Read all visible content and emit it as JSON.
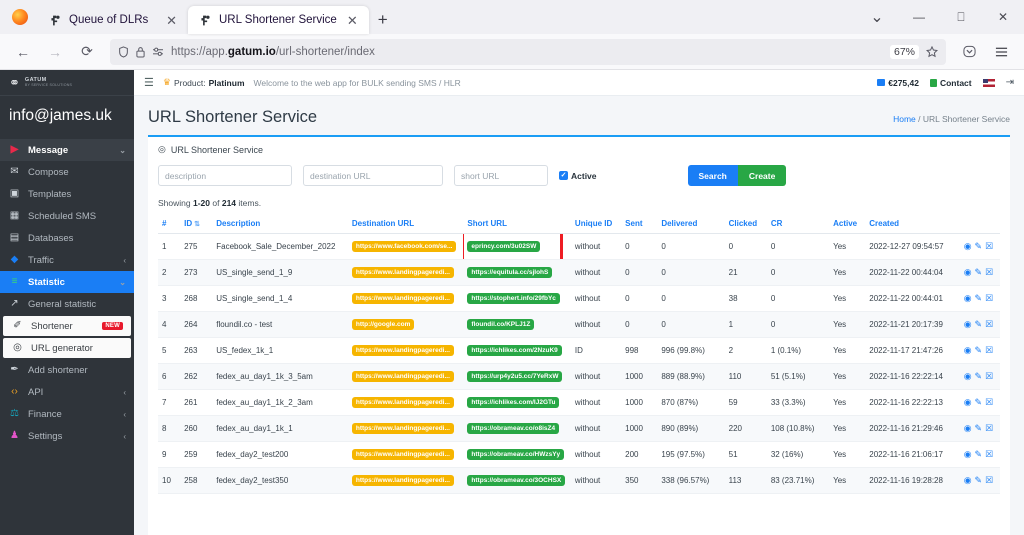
{
  "browser": {
    "tabs": [
      {
        "title": "Queue of DLRs",
        "active": false
      },
      {
        "title": "URL Shortener Service",
        "active": true
      }
    ],
    "new_tab_label": "+",
    "url_prefix": "https://app.",
    "url_domain": "gatum.io",
    "url_path": "/url-shortener/index",
    "zoom_level": "67%",
    "window_controls": {
      "minimize": "—",
      "maximize": "❐",
      "close": "✕"
    }
  },
  "sidebar": {
    "brand_line1": "GATUM",
    "brand_line2": "BY SERVICE SOLUTIONS",
    "account": "info@james.uk",
    "items": [
      {
        "label": "Message",
        "icon": "message-icon",
        "chevron": "⌄",
        "style": "group"
      },
      {
        "label": "Compose",
        "icon": "envelope-icon",
        "chevron": "",
        "style": "plain"
      },
      {
        "label": "Templates",
        "icon": "template-icon",
        "chevron": "",
        "style": "plain"
      },
      {
        "label": "Scheduled SMS",
        "icon": "calendar-icon",
        "chevron": "",
        "style": "plain"
      },
      {
        "label": "Databases",
        "icon": "database-icon",
        "chevron": "",
        "style": "plain"
      },
      {
        "label": "Traffic",
        "icon": "traffic-icon",
        "chevron": "‹",
        "style": "plain"
      },
      {
        "label": "Statistic",
        "icon": "chart-icon",
        "chevron": "⌄",
        "style": "active-blue"
      },
      {
        "label": "General statistic",
        "icon": "line-chart-icon",
        "chevron": "",
        "style": "plain"
      },
      {
        "label": "Shortener",
        "icon": "pencil-icon",
        "chevron": "",
        "style": "white",
        "badge": "NEW"
      },
      {
        "label": "URL generator",
        "icon": "target-icon",
        "chevron": "",
        "style": "white"
      },
      {
        "label": "Add shortener",
        "icon": "quill-icon",
        "chevron": "",
        "style": "plain"
      },
      {
        "label": "API",
        "icon": "code-icon",
        "chevron": "‹",
        "style": "plain"
      },
      {
        "label": "Finance",
        "icon": "finance-icon",
        "chevron": "‹",
        "style": "plain"
      },
      {
        "label": "Settings",
        "icon": "users-icon",
        "chevron": "‹",
        "style": "plain"
      }
    ]
  },
  "topbar": {
    "product_label": "Product:",
    "product_value": "Platinum",
    "welcome": "Welcome to the web app for BULK sending SMS / HLR",
    "balance": "€275,42",
    "contact": "Contact",
    "language": "en-US"
  },
  "page": {
    "title": "URL Shortener Service",
    "breadcrumb_home": "Home",
    "breadcrumb_sep": "/",
    "breadcrumb_current": "URL Shortener Service",
    "panel_title": "URL Shortener Service"
  },
  "filters": {
    "description_placeholder": "description",
    "destination_placeholder": "destination URL",
    "short_placeholder": "short URL",
    "active_label": "Active",
    "active_checked": true,
    "search_label": "Search",
    "create_label": "Create"
  },
  "summary": {
    "prefix": "Showing",
    "range": "1-20",
    "of": "of",
    "total": "214",
    "suffix": "items."
  },
  "table": {
    "columns": [
      "#",
      "ID",
      "Description",
      "Destination URL",
      "Short URL",
      "Unique ID",
      "Sent",
      "Delivered",
      "Clicked",
      "CR",
      "Active",
      "Created",
      ""
    ],
    "sort_column": "ID",
    "rows": [
      {
        "n": "1",
        "id": "275",
        "desc": "Facebook_Sale_December_2022",
        "dest": "https://www.facebook.com/se...",
        "short": "eprincy.com/3u02SW",
        "uid": "without",
        "sent": "0",
        "delivered": "0",
        "clicked": "0",
        "cr": "0",
        "active": "Yes",
        "created": "2022-12-27 09:54:57",
        "highlight": true
      },
      {
        "n": "2",
        "id": "273",
        "desc": "US_single_send_1_9",
        "dest": "https://www.landingpageredi...",
        "short": "https://equitula.cc/sjIohS",
        "uid": "without",
        "sent": "0",
        "delivered": "0",
        "clicked": "21",
        "cr": "0",
        "active": "Yes",
        "created": "2022-11-22 00:44:04",
        "highlight": false
      },
      {
        "n": "3",
        "id": "268",
        "desc": "US_single_send_1_4",
        "dest": "https://www.landingpageredi...",
        "short": "https://stophert.info/29fbYc",
        "uid": "without",
        "sent": "0",
        "delivered": "0",
        "clicked": "38",
        "cr": "0",
        "active": "Yes",
        "created": "2022-11-22 00:44:01",
        "highlight": false
      },
      {
        "n": "4",
        "id": "264",
        "desc": "floundil.co - test",
        "dest": "http://google.com",
        "short": "floundil.co/KPLJ1Z",
        "uid": "without",
        "sent": "0",
        "delivered": "0",
        "clicked": "1",
        "cr": "0",
        "active": "Yes",
        "created": "2022-11-21 20:17:39",
        "highlight": false
      },
      {
        "n": "5",
        "id": "263",
        "desc": "US_fedex_1k_1",
        "dest": "https://www.landingpageredi...",
        "short": "https://ichlikes.com/2NzuK9",
        "uid": "ID",
        "sent": "998",
        "delivered": "996 (99.8%)",
        "clicked": "2",
        "cr": "1 (0.1%)",
        "active": "Yes",
        "created": "2022-11-17 21:47:26",
        "highlight": false
      },
      {
        "n": "6",
        "id": "262",
        "desc": "fedex_au_day1_1k_3_5am",
        "dest": "https://www.landingpageredi...",
        "short": "https://urp4y2u5.cc/7YeRxW",
        "uid": "without",
        "sent": "1000",
        "delivered": "889 (88.9%)",
        "clicked": "110",
        "cr": "51 (5.1%)",
        "active": "Yes",
        "created": "2022-11-16 22:22:14",
        "highlight": false
      },
      {
        "n": "7",
        "id": "261",
        "desc": "fedex_au_day1_1k_2_3am",
        "dest": "https://www.landingpageredi...",
        "short": "https://ichlikes.com/IJ2GTu",
        "uid": "without",
        "sent": "1000",
        "delivered": "870 (87%)",
        "clicked": "59",
        "cr": "33 (3.3%)",
        "active": "Yes",
        "created": "2022-11-16 22:22:13",
        "highlight": false
      },
      {
        "n": "8",
        "id": "260",
        "desc": "fedex_au_day1_1k_1",
        "dest": "https://www.landingpageredi...",
        "short": "https://obrameav.co/o8isZ4",
        "uid": "without",
        "sent": "1000",
        "delivered": "890 (89%)",
        "clicked": "220",
        "cr": "108 (10.8%)",
        "active": "Yes",
        "created": "2022-11-16 21:29:46",
        "highlight": false
      },
      {
        "n": "9",
        "id": "259",
        "desc": "fedex_day2_test200",
        "dest": "https://www.landingpageredi...",
        "short": "https://obrameav.co/HWzsYy",
        "uid": "without",
        "sent": "200",
        "delivered": "195 (97.5%)",
        "clicked": "51",
        "cr": "32 (16%)",
        "active": "Yes",
        "created": "2022-11-16 21:06:17",
        "highlight": false
      },
      {
        "n": "10",
        "id": "258",
        "desc": "fedex_day2_test350",
        "dest": "https://www.landingpageredi...",
        "short": "https://obrameav.co/3OCHSX",
        "uid": "without",
        "sent": "350",
        "delivered": "338 (96.57%)",
        "clicked": "113",
        "cr": "83 (23.71%)",
        "active": "Yes",
        "created": "2022-11-16 19:28:28",
        "highlight": false
      }
    ],
    "actions": {
      "view": "view-icon",
      "edit": "edit-icon",
      "delete": "delete-icon"
    }
  },
  "colors": {
    "accent_blue": "#1a7ef5",
    "green": "#28a745",
    "yellow": "#f6b500",
    "red_highlight": "#ee1d23",
    "sidebar_bg": "#2f343a"
  }
}
